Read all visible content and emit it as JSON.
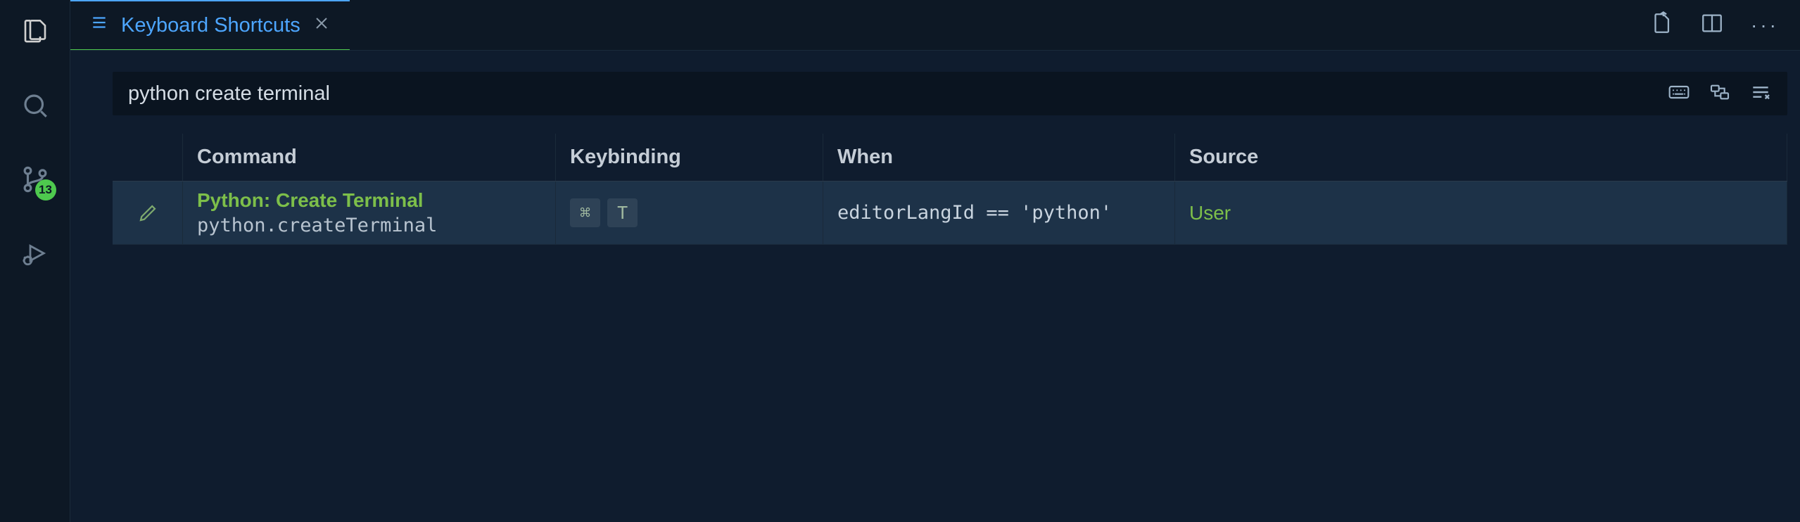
{
  "activity": {
    "items": [
      {
        "name": "explorer"
      },
      {
        "name": "search"
      },
      {
        "name": "source-control",
        "badge": "13"
      },
      {
        "name": "run-debug"
      }
    ]
  },
  "tab": {
    "title": "Keyboard Shortcuts"
  },
  "search": {
    "value": "python create terminal"
  },
  "table": {
    "headers": {
      "command": "Command",
      "keybinding": "Keybinding",
      "when": "When",
      "source": "Source"
    },
    "rows": [
      {
        "title": "Python: Create Terminal",
        "id": "python.createTerminal",
        "keys": [
          "⌘",
          "T"
        ],
        "when": "editorLangId == 'python'",
        "source": "User"
      }
    ]
  }
}
